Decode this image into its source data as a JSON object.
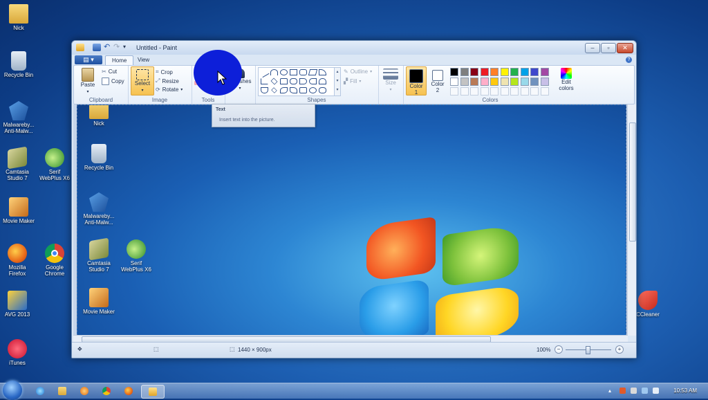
{
  "desktop_icons": [
    {
      "id": "nick",
      "label": "Nick"
    },
    {
      "id": "recycle",
      "label": "Recycle Bin"
    },
    {
      "id": "malwarebytes",
      "label": "Malwareby...\nAnti-Malw..."
    },
    {
      "id": "camtasia",
      "label": "Camtasia\nStudio 7"
    },
    {
      "id": "serif",
      "label": "Serif\nWebPlus X6"
    },
    {
      "id": "moviemaker",
      "label": "Movie Maker"
    },
    {
      "id": "firefox",
      "label": "Mozilla\nFirefox"
    },
    {
      "id": "chrome",
      "label": "Google\nChrome"
    },
    {
      "id": "avg",
      "label": "AVG 2013"
    },
    {
      "id": "itunes",
      "label": "iTunes"
    },
    {
      "id": "ccleaner",
      "label": "CCleaner"
    }
  ],
  "canvas_icons": [
    {
      "label": "Nick"
    },
    {
      "label": "Recycle Bin"
    },
    {
      "label": "Malwareby...\nAnti-Malw..."
    },
    {
      "label": "Camtasia\nStudio 7"
    },
    {
      "label": "Serif\nWebPlus X6"
    },
    {
      "label": "Movie Maker"
    }
  ],
  "window": {
    "title": "Untitled - Paint",
    "controls": {
      "min": "–",
      "max": "▫",
      "close": "✕"
    },
    "file_menu": "▤ ▾",
    "tabs": {
      "home": "Home",
      "view": "View"
    },
    "help": "?"
  },
  "ribbon": {
    "clipboard": {
      "label": "Clipboard",
      "paste": "Paste",
      "cut": "Cut",
      "copy": "Copy"
    },
    "image": {
      "label": "Image",
      "select": "Select",
      "crop": "Crop",
      "resize": "Resize",
      "rotate": "Rotate"
    },
    "tools": {
      "label": "Tools"
    },
    "brushes": {
      "label": "shes"
    },
    "shapes": {
      "label": "Shapes",
      "outline": "Outline",
      "fill": "Fill"
    },
    "size": {
      "label": "Size"
    },
    "colors": {
      "label": "Colors",
      "color1": "Color\n1",
      "color2": "Color\n2",
      "edit": "Edit\ncolors",
      "color1_value": "#000000",
      "color2_value": "#ffffff",
      "palette_row1": [
        "#000000",
        "#7f7f7f",
        "#880015",
        "#ed1c24",
        "#ff7f27",
        "#fff200",
        "#22b14c",
        "#00a2e8",
        "#3f48cc",
        "#a349a4"
      ],
      "palette_row2": [
        "#ffffff",
        "#c3c3c3",
        "#b97a57",
        "#ffaec9",
        "#ffc90e",
        "#efe4b0",
        "#b5e61d",
        "#99d9ea",
        "#7092be",
        "#c8bfe7"
      ]
    }
  },
  "tooltip": {
    "title": "Text",
    "body": "Insert text into the picture."
  },
  "statusbar": {
    "dimensions": "1440 × 900px",
    "zoom": "100%",
    "zoom_out": "−",
    "zoom_in": "+",
    "move": "✥",
    "select_size": "⬚"
  },
  "taskbar": {
    "clock": "10:53 AM"
  }
}
